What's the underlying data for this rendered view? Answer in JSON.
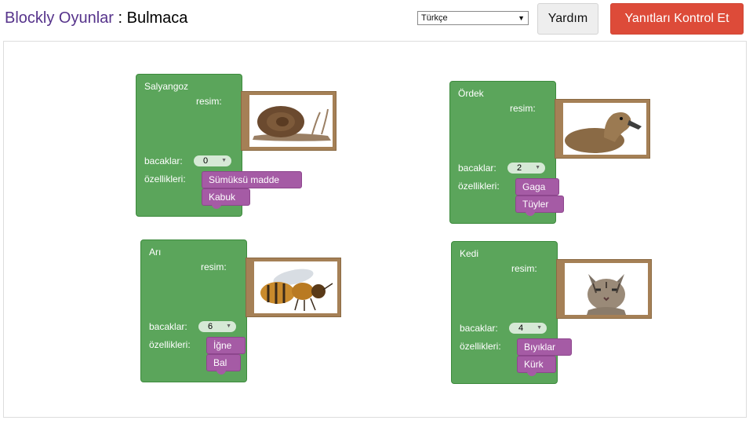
{
  "header": {
    "brand": "Blockly Oyunlar",
    "separator": " : ",
    "game": "Bulmaca",
    "language": "Türkçe",
    "help_label": "Yardım",
    "check_label": "Yanıtları Kontrol Et"
  },
  "labels": {
    "picture": "resim:",
    "legs": "bacaklar:",
    "traits": "özellikleri:"
  },
  "animals": [
    {
      "name": "Salyangoz",
      "legs": "0",
      "traits": [
        "Sümüksü madde",
        "Kabuk"
      ],
      "image": "snail"
    },
    {
      "name": "Ördek",
      "legs": "2",
      "traits": [
        "Gaga",
        "Tüyler"
      ],
      "image": "duck"
    },
    {
      "name": "Arı",
      "legs": "6",
      "traits": [
        "İğne",
        "Bal"
      ],
      "image": "bee"
    },
    {
      "name": "Kedi",
      "legs": "4",
      "traits": [
        "Bıyıklar",
        "Kürk"
      ],
      "image": "cat"
    }
  ],
  "colors": {
    "animal_block": "#5ba55b",
    "trait_block": "#a55ba5",
    "picture_frame": "#a58056",
    "check_button": "#dd4b39"
  }
}
